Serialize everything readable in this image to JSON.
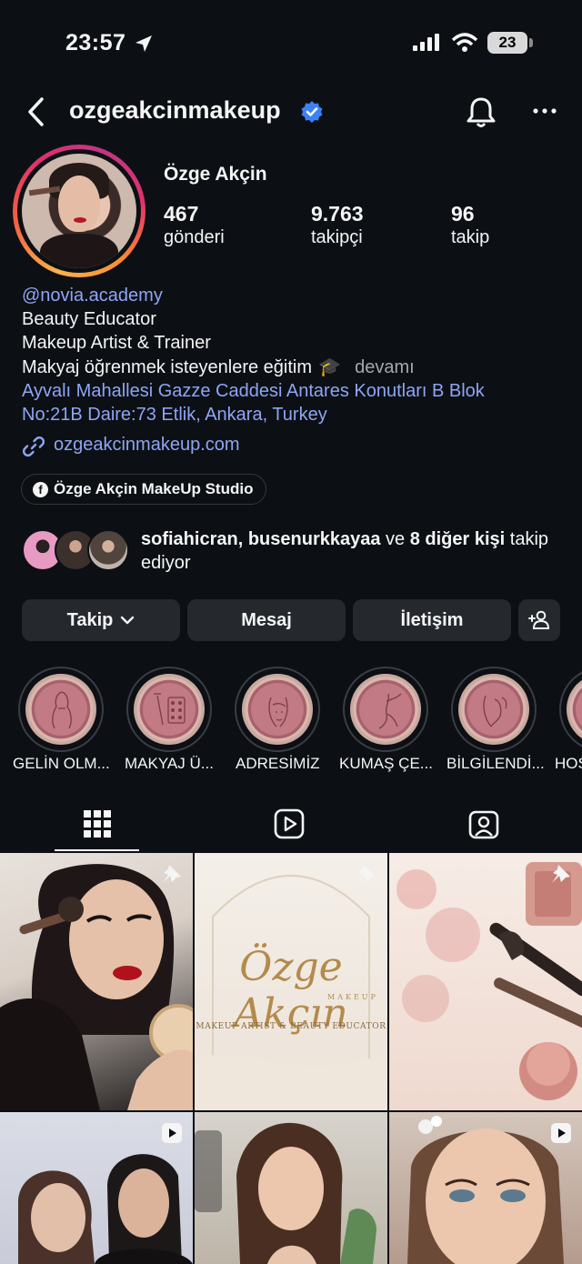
{
  "status_bar": {
    "time": "23:57",
    "battery": "23"
  },
  "header": {
    "username": "ozgeakcinmakeup"
  },
  "profile": {
    "full_name": "Özge Akçin",
    "stats": [
      {
        "value": "467",
        "label": "gönderi"
      },
      {
        "value": "9.763",
        "label": "takipçi"
      },
      {
        "value": "96",
        "label": "takip"
      }
    ],
    "bio": {
      "mention": "@novia.academy",
      "line1": "Beauty Educator",
      "line2": "Makeup Artist & Trainer",
      "line3": "Makyaj öğrenmek isteyenlere eğitim",
      "more": "devamı",
      "address1": "Ayvalı Mahallesi Gazze Caddesi Antares Konutları B Blok",
      "address2": "No:21B Daire:73 Etlik, Ankara, Turkey"
    },
    "website": "ozgeakcinmakeup.com",
    "facebook_page": "Özge Akçin MakeUp Studio",
    "followed_by": {
      "user1": "sofiahicran",
      "sep": ", ",
      "user2": "busenurkkayaa",
      "mid": " ve ",
      "others": "8 diğer kişi",
      "end": " takip ediyor"
    }
  },
  "buttons": {
    "follow": "Takip",
    "message": "Mesaj",
    "contact": "İletişim"
  },
  "highlights": [
    {
      "label": "GELİN OLM..."
    },
    {
      "label": "MAKYAJ Ü..."
    },
    {
      "label": "ADRESİMİZ"
    },
    {
      "label": "KUMAŞ ÇE..."
    },
    {
      "label": "BİLGİLENDİ..."
    },
    {
      "label": "HOŞ"
    }
  ],
  "posts": {
    "logo_title": "Özge Akçın",
    "logo_sub": "MAKEUP",
    "logo_tagline": "MAKEUP ARTIST & BEAUTY EDUCATOR"
  },
  "colors": {
    "background": "#0c1014",
    "link": "#8ea5f5",
    "verified": "#3b82f6",
    "button": "#25292e"
  }
}
